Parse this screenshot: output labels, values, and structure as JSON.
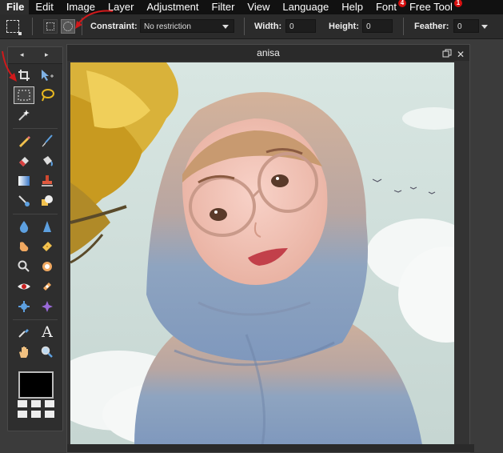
{
  "menubar": {
    "items": [
      {
        "label": "File"
      },
      {
        "label": "Edit"
      },
      {
        "label": "Image"
      },
      {
        "label": "Layer"
      },
      {
        "label": "Adjustment"
      },
      {
        "label": "Filter"
      },
      {
        "label": "View"
      },
      {
        "label": "Language"
      },
      {
        "label": "Help"
      },
      {
        "label": "Font",
        "badge": "4"
      },
      {
        "label": "Free Tool",
        "badge": "1"
      }
    ]
  },
  "options": {
    "constraint_label": "Constraint:",
    "constraint_value": "No restriction",
    "width_label": "Width:",
    "width_value": "0",
    "height_label": "Height:",
    "height_value": "0",
    "feather_label": "Feather:",
    "feather_value": "0"
  },
  "toolbox": {
    "prev_glyph": "◂",
    "next_glyph": "▸",
    "active_tool": "rectangle-select",
    "foreground_color": "#000000"
  },
  "document": {
    "title": "anisa"
  },
  "colors": {
    "annotation": "#d0191b",
    "menubar_bg": "#111111",
    "workspace_bg": "#3b3b3b"
  }
}
